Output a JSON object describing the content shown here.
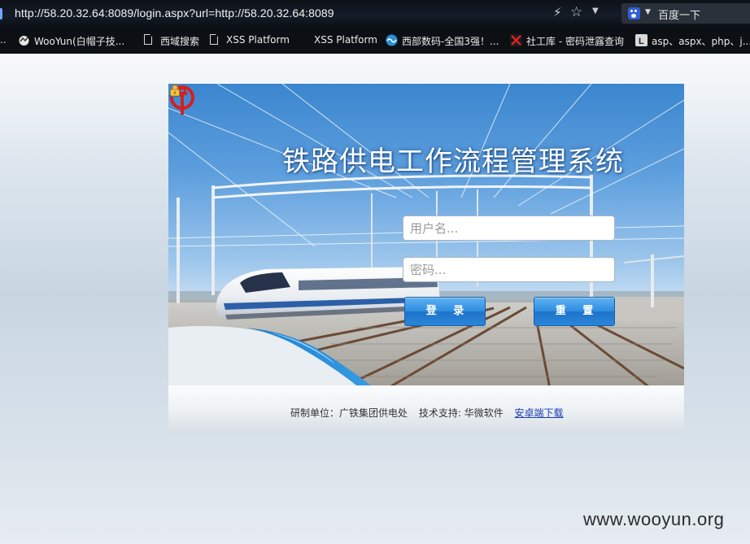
{
  "browser": {
    "url": "http://58.20.32.64:8089/login.aspx?url=http://58.20.32.64:8089",
    "search_engine_label": "百度一下",
    "bookmarks": [
      {
        "label": "WooYun(白帽子技..."
      },
      {
        "label": "西域搜索"
      },
      {
        "label": "XSS Platform"
      },
      {
        "label": "XSS Platform"
      },
      {
        "label": "西部数码-全国3强！..."
      },
      {
        "label": "社工库 - 密码泄露查询"
      },
      {
        "label": "asp、aspx、php、j..."
      }
    ]
  },
  "login": {
    "title": "铁路供电工作流程管理系统",
    "username_placeholder": "用户名...",
    "password_placeholder": "密码...",
    "login_button": "登 录",
    "reset_button": "重 置"
  },
  "footer": {
    "developer": "研制单位：广铁集团供电处",
    "support": "技术支持: 华微软件",
    "android_link": "安卓端下载"
  },
  "watermark": "www.wooyun.org",
  "colors": {
    "button_blue": "#2f8ee0",
    "logo_red": "#d42020",
    "link_blue": "#1a3db3"
  }
}
